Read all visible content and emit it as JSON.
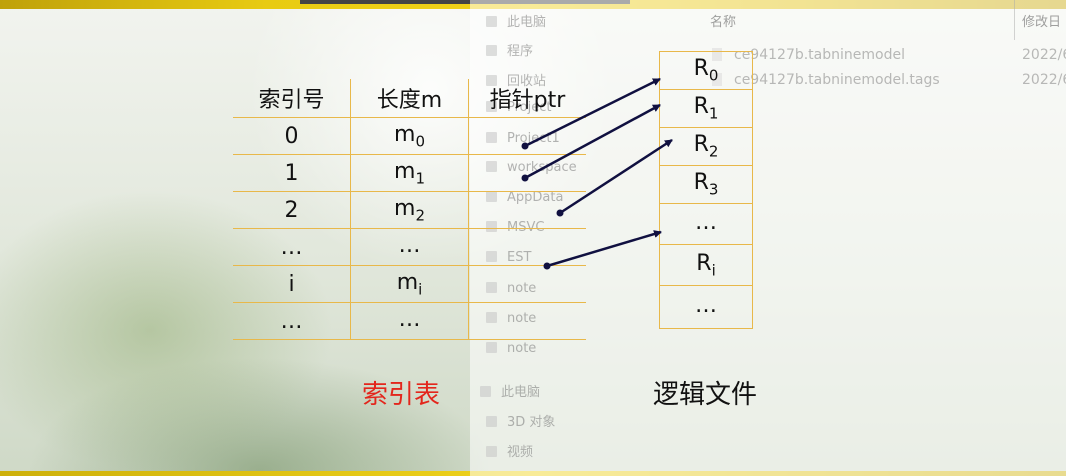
{
  "explorer": {
    "nav": [
      "此电脑",
      "程序",
      "回收站",
      "Project",
      "Project1",
      "workspace",
      "AppData",
      "MSVC",
      "EST",
      "note",
      "note",
      "note",
      "此电脑",
      "3D 对象",
      "视频"
    ],
    "columns": {
      "name": "名称",
      "modified": "修改日"
    },
    "files": [
      {
        "name": "ce94127b.tabninemodel",
        "date": "2022/6"
      },
      {
        "name": "ce94127b.tabninemodel.tags",
        "date": "2022/6"
      }
    ]
  },
  "index_table": {
    "headers": [
      "索引号",
      "长度m",
      "指针ptr"
    ],
    "rows": [
      {
        "idx": "0",
        "len": "m",
        "len_sub": "0"
      },
      {
        "idx": "1",
        "len": "m",
        "len_sub": "1"
      },
      {
        "idx": "2",
        "len": "m",
        "len_sub": "2"
      },
      {
        "idx": "…",
        "len": "…",
        "len_sub": ""
      },
      {
        "idx": "i",
        "len": "m",
        "len_sub": "i"
      },
      {
        "idx": "…",
        "len": "…",
        "len_sub": ""
      }
    ],
    "caption": "索引表"
  },
  "logical_file": {
    "records": [
      {
        "base": "R",
        "sub": "0"
      },
      {
        "base": "R",
        "sub": "1"
      },
      {
        "base": "R",
        "sub": "2"
      },
      {
        "base": "R",
        "sub": "3"
      },
      {
        "base": "…",
        "sub": ""
      },
      {
        "base": "R",
        "sub": "i"
      },
      {
        "base": "…",
        "sub": ""
      }
    ],
    "caption": "逻辑文件"
  },
  "colors": {
    "grid": "#e8b84a",
    "arrow": "#101040",
    "caption_red": "#e3261c",
    "band": "#f1d21a"
  }
}
